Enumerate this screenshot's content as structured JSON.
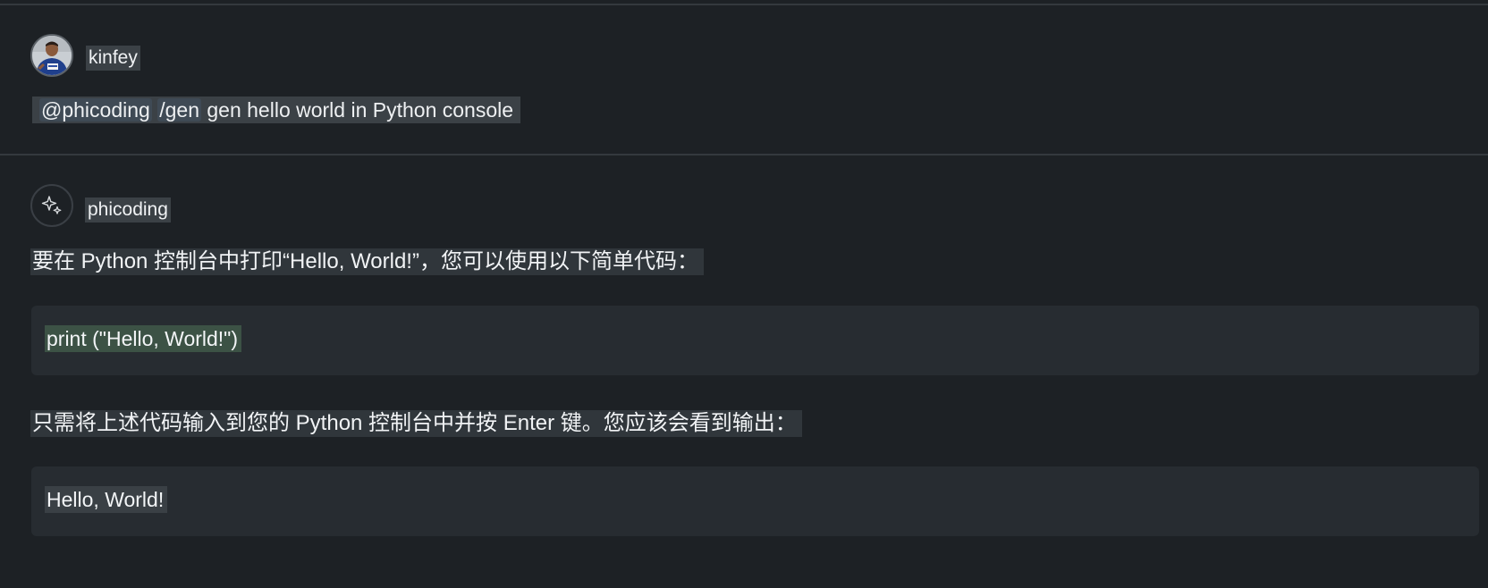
{
  "conversation": {
    "user_message": {
      "author": "kinfey",
      "avatar_icon": "user-avatar-photo",
      "agent_mention": "@phicoding",
      "slash_command": "/gen",
      "prompt_text": "gen hello world in Python console"
    },
    "assistant_message": {
      "author": "phicoding",
      "avatar_icon": "sparkles-icon",
      "intro_text": "要在 Python 控制台中打印“Hello, World!”，您可以使用以下简单代码：",
      "code_snippet": "print (\"Hello, World!\")",
      "instruction_text": "只需将上述代码输入到您的 Python 控制台中并按 Enter 键。您应该会看到输出：",
      "output_text": "Hello, World!"
    }
  },
  "colors": {
    "background": "#1d2125",
    "code_background": "#272c31",
    "highlight": "#3b4146",
    "code_highlight": "#3c5245",
    "text": "#f0f2f4"
  }
}
